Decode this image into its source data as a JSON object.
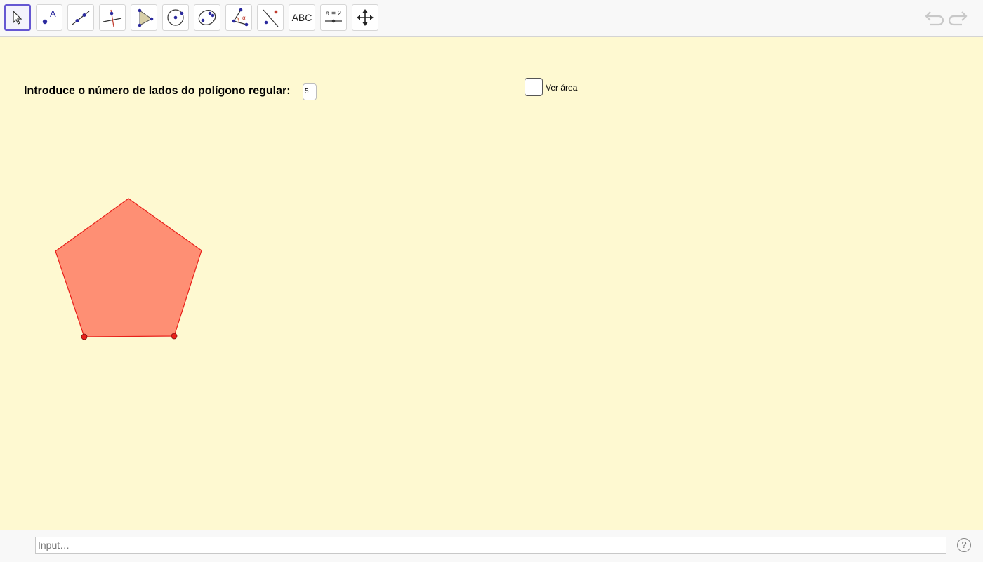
{
  "toolbar": {
    "tools": [
      {
        "name": "move-tool",
        "icon": "arrow-cursor-icon"
      },
      {
        "name": "point-tool",
        "icon": "point-icon",
        "label": "A"
      },
      {
        "name": "line-tool",
        "icon": "line-icon"
      },
      {
        "name": "perpendicular-line-tool",
        "icon": "perpendicular-icon"
      },
      {
        "name": "polygon-tool",
        "icon": "polygon-icon"
      },
      {
        "name": "circle-tool",
        "icon": "circle-center-icon"
      },
      {
        "name": "conic-tool",
        "icon": "ellipse-icon"
      },
      {
        "name": "angle-tool",
        "icon": "angle-icon",
        "label": "α"
      },
      {
        "name": "reflect-tool",
        "icon": "reflect-icon"
      },
      {
        "name": "text-tool",
        "icon": "text-icon",
        "label": "ABC"
      },
      {
        "name": "slider-tool",
        "icon": "slider-icon",
        "label": "a = 2"
      },
      {
        "name": "move-graphics-view-tool",
        "icon": "move-view-icon"
      }
    ],
    "undo_icon": "undo-icon",
    "redo_icon": "redo-icon"
  },
  "canvas": {
    "prompt_label": "Introduce o número de lados do polígono regular:",
    "sides_value": "5",
    "checkbox_label": "Ver área",
    "checkbox_checked": false,
    "polygon": {
      "sides": 5,
      "fill": "#fe8f74",
      "stroke": "#e8211a"
    },
    "background": "#fef9d1"
  },
  "input_bar": {
    "placeholder": "Input…",
    "help_label": "?"
  }
}
